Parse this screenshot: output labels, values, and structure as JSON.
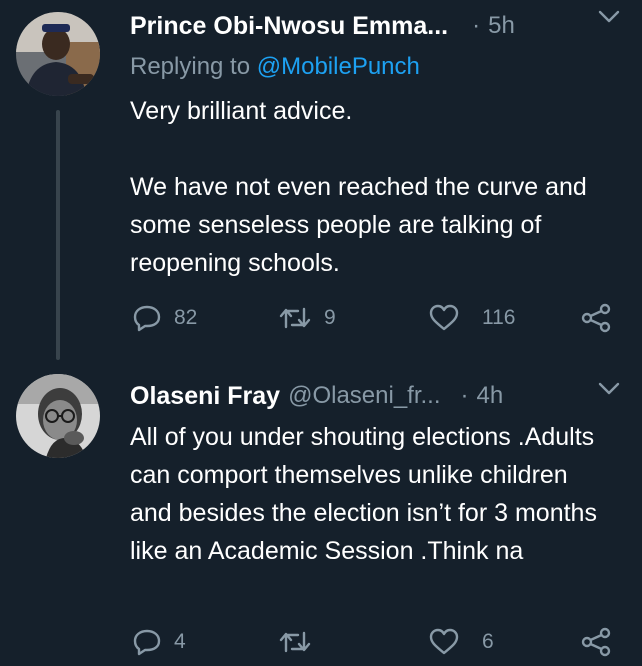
{
  "tweets": [
    {
      "display_name": "Prince Obi-Nwosu Emma...",
      "handle": "",
      "separator": "·",
      "time": "5h",
      "replying_prefix": "Replying to",
      "replying_handle": "@MobilePunch",
      "text": "Very brilliant advice.\n\nWe have not even reached the curve and some senseless people are talking of reopening schools.",
      "replies": "82",
      "retweets": "9",
      "likes": "116",
      "avatar_icon": "avatar-photo"
    },
    {
      "display_name": "Olaseni Fray",
      "handle": "@Olaseni_fr...",
      "separator": "·",
      "time": "4h",
      "text": "All of you under shouting elections .Adults can comport themselves unlike children and besides the election isn’t for 3 months like an Academic Session .Think na",
      "replies": "4",
      "retweets": "",
      "likes": "6",
      "avatar_icon": "avatar-photo"
    }
  ],
  "icons": {
    "reply": "reply-icon",
    "retweet": "retweet-icon",
    "like": "like-icon",
    "share": "share-icon",
    "caret": "chevron-down-icon"
  },
  "colors": {
    "background": "#15202b",
    "secondary_text": "#8899a6",
    "link": "#1da1f2",
    "thread_line": "#38444d"
  }
}
